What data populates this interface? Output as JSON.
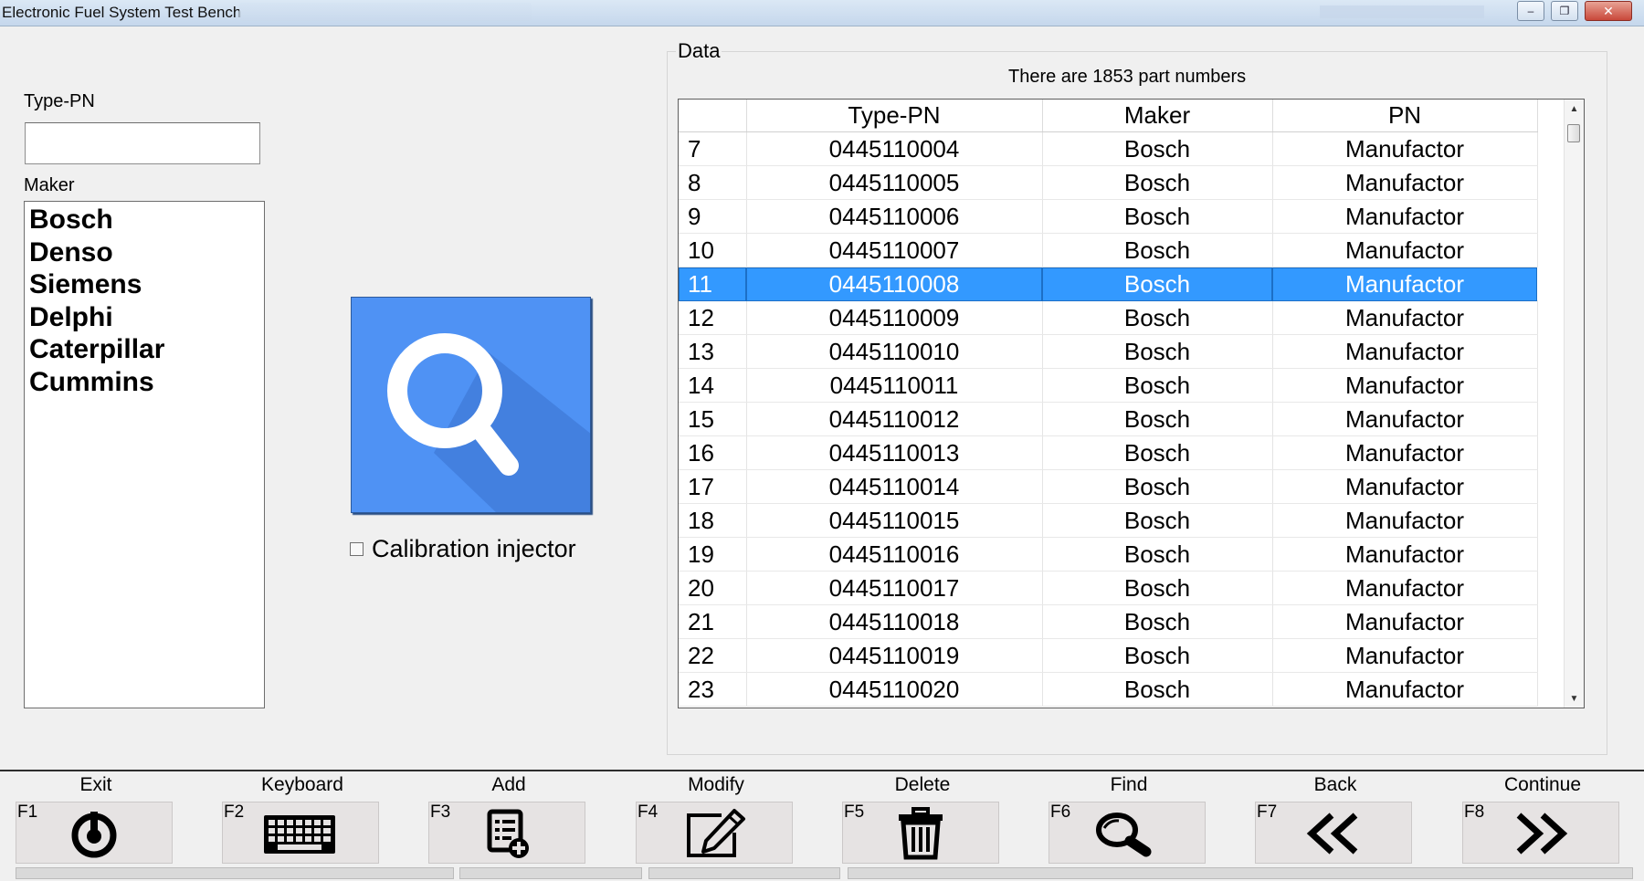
{
  "window": {
    "title": "Electronic Fuel System Test Bench",
    "buttons": {
      "minimize": "–",
      "maximize": "❐",
      "close": "✕"
    }
  },
  "left": {
    "type_pn_label": "Type-PN",
    "type_pn_value": "",
    "maker_label": "Maker",
    "makers": [
      "Bosch",
      "Denso",
      "Siemens",
      "Delphi",
      "Caterpillar",
      "Cummins"
    ]
  },
  "center": {
    "search_icon": "search-magnifier-icon",
    "calibration_label": "Calibration injector",
    "calibration_checked": false
  },
  "data": {
    "group_title": "Data",
    "count_text": "There are 1853 part numbers",
    "columns": [
      "",
      "Type-PN",
      "Maker",
      "PN"
    ],
    "selected_row": "11",
    "rows": [
      [
        "7",
        "0445110004",
        "Bosch",
        "Manufactor"
      ],
      [
        "8",
        "0445110005",
        "Bosch",
        "Manufactor"
      ],
      [
        "9",
        "0445110006",
        "Bosch",
        "Manufactor"
      ],
      [
        "10",
        "0445110007",
        "Bosch",
        "Manufactor"
      ],
      [
        "11",
        "0445110008",
        "Bosch",
        "Manufactor"
      ],
      [
        "12",
        "0445110009",
        "Bosch",
        "Manufactor"
      ],
      [
        "13",
        "0445110010",
        "Bosch",
        "Manufactor"
      ],
      [
        "14",
        "0445110011",
        "Bosch",
        "Manufactor"
      ],
      [
        "15",
        "0445110012",
        "Bosch",
        "Manufactor"
      ],
      [
        "16",
        "0445110013",
        "Bosch",
        "Manufactor"
      ],
      [
        "17",
        "0445110014",
        "Bosch",
        "Manufactor"
      ],
      [
        "18",
        "0445110015",
        "Bosch",
        "Manufactor"
      ],
      [
        "19",
        "0445110016",
        "Bosch",
        "Manufactor"
      ],
      [
        "20",
        "0445110017",
        "Bosch",
        "Manufactor"
      ],
      [
        "21",
        "0445110018",
        "Bosch",
        "Manufactor"
      ],
      [
        "22",
        "0445110019",
        "Bosch",
        "Manufactor"
      ],
      [
        "23",
        "0445110020",
        "Bosch",
        "Manufactor"
      ]
    ]
  },
  "toolbar": {
    "buttons": [
      {
        "label": "Exit",
        "key": "F1",
        "icon": "power-icon"
      },
      {
        "label": "Keyboard",
        "key": "F2",
        "icon": "keyboard-icon"
      },
      {
        "label": "Add",
        "key": "F3",
        "icon": "add-list-icon"
      },
      {
        "label": "Modify",
        "key": "F4",
        "icon": "edit-icon"
      },
      {
        "label": "Delete",
        "key": "F5",
        "icon": "trash-icon"
      },
      {
        "label": "Find",
        "key": "F6",
        "icon": "find-icon"
      },
      {
        "label": "Back",
        "key": "F7",
        "icon": "double-chevron-left-icon"
      },
      {
        "label": "Continue",
        "key": "F8",
        "icon": "double-chevron-right-icon"
      }
    ]
  },
  "colors": {
    "selection": "#3399ff",
    "search_button": "#4f92f4",
    "background": "#f0f0f0"
  }
}
